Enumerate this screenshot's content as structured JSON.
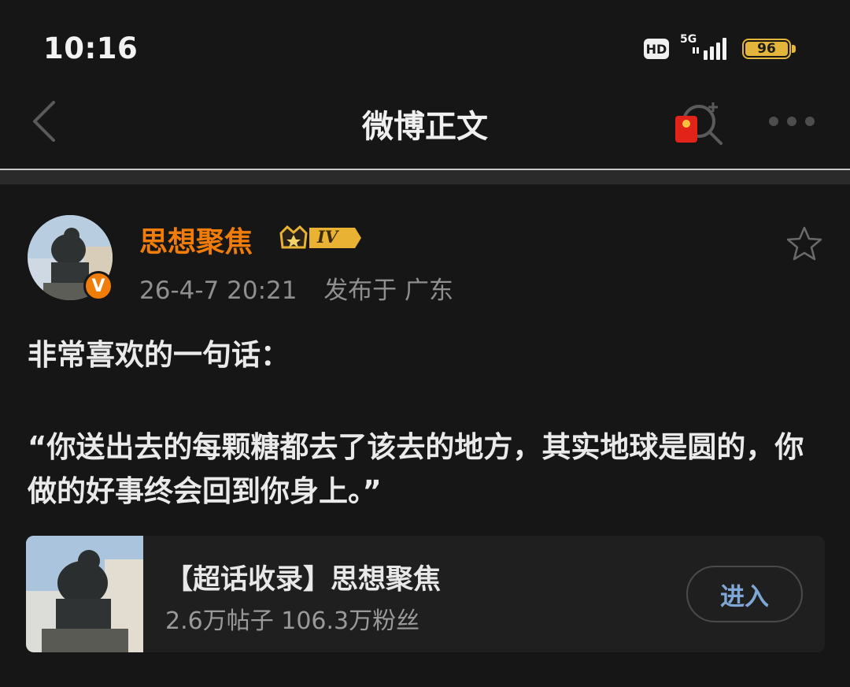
{
  "status_bar": {
    "time": "10:16",
    "hd": "HD",
    "network": "5G",
    "battery": "96",
    "battery_color": "#e4b53b"
  },
  "nav": {
    "title": "微博正文",
    "back_icon": "chevron-left-icon",
    "red_packet_icon": "red-packet-icon",
    "search_icon": "search-plus-icon",
    "more_icon": "more-dots-icon"
  },
  "post": {
    "username": "思想聚焦",
    "username_color": "#f07c0a",
    "level_badge": "IV",
    "verified_badge": "V",
    "timestamp": "26-4-7 20:21",
    "location": "发布于 广东",
    "text_line1": "非常喜欢的一句话：",
    "quote": "“你送出去的每颗糖都去了该去的地方，其实地球是圆的，你做的好事终会回到你身上。”"
  },
  "supertopic_card": {
    "title": "【超话收录】思想聚焦",
    "stats": "2.6万帖子 106.3万粉丝",
    "button": "进入",
    "button_color": "#7fa7d6"
  }
}
